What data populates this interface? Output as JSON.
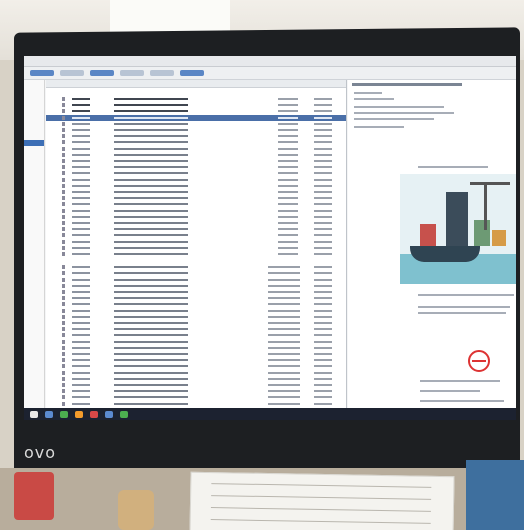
{
  "scene": {
    "description": "",
    "monitor": {
      "brand": "ovo"
    },
    "colors": {
      "screen_bg": "#f4f5f6",
      "selection": "#4a6fa8",
      "taskbar": "#1c2230",
      "stamp": "#dd3333"
    },
    "icons": [
      "folder-icon",
      "mail-icon",
      "windows-start-icon",
      "browser-icon",
      "file-explorer-icon"
    ]
  }
}
